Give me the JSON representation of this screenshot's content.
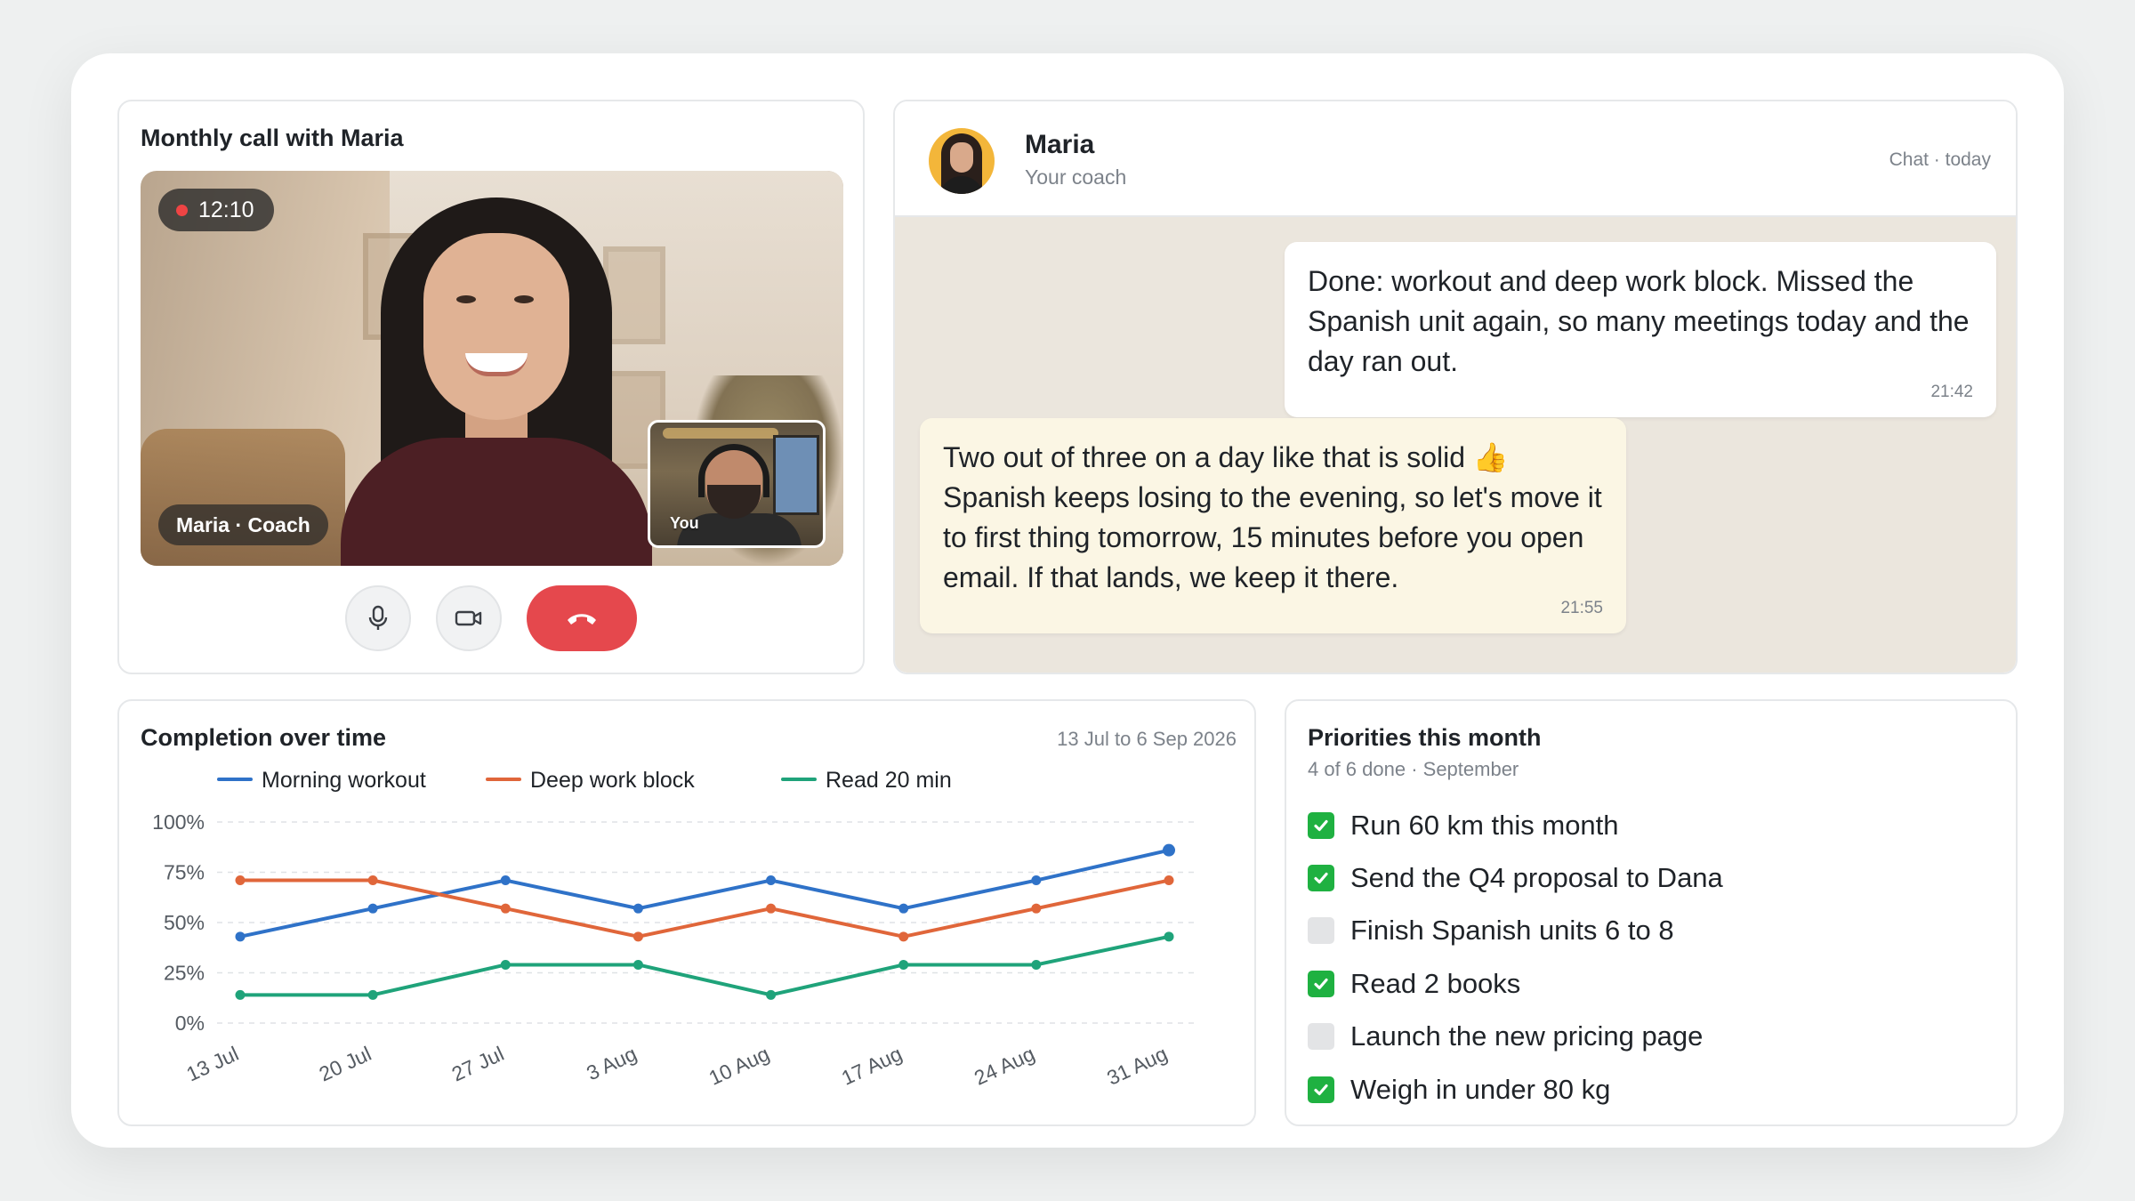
{
  "call": {
    "title": "Monthly call with Maria",
    "recording_time": "12:10",
    "remote_label": "Maria · Coach",
    "self_label": "You",
    "controls": [
      "microphone",
      "camera",
      "end-call"
    ],
    "accent_end_call": "#e5484d"
  },
  "chat": {
    "name": "Maria",
    "role": "Your coach",
    "meta": "Chat · today",
    "messages": [
      {
        "direction": "outgoing",
        "text": "Done: workout and deep work block. Missed the Spanish unit again, so many meetings today and the day ran out.",
        "time": "21:42"
      },
      {
        "direction": "incoming",
        "text": "Two out of three on a day like that is solid 👍 Spanish keeps losing to the evening, so let's move it to first thing tomorrow, 15 minutes before you open email. If that lands, we keep it there.",
        "time": "21:55"
      }
    ]
  },
  "chart": {
    "title": "Completion over time",
    "range": "13 Jul to 6 Sep 2026"
  },
  "chart_data": {
    "type": "line",
    "categories": [
      "13 Jul",
      "20 Jul",
      "27 Jul",
      "3 Aug",
      "10 Aug",
      "17 Aug",
      "24 Aug",
      "31 Aug"
    ],
    "y_ticks": [
      "0%",
      "25%",
      "50%",
      "75%",
      "100%"
    ],
    "ylim": [
      0,
      100
    ],
    "grid": true,
    "legend": "top",
    "series": [
      {
        "name": "Morning workout",
        "color": "#2f72c8",
        "values": [
          43,
          57,
          71,
          57,
          71,
          57,
          71,
          86
        ]
      },
      {
        "name": "Deep work block",
        "color": "#e0663a",
        "values": [
          71,
          71,
          57,
          43,
          57,
          43,
          57,
          71
        ]
      },
      {
        "name": "Read 20 min",
        "color": "#1fa37a",
        "values": [
          14,
          14,
          29,
          29,
          14,
          29,
          29,
          43
        ]
      }
    ]
  },
  "priorities": {
    "title": "Priorities this month",
    "subtitle": "4 of 6 done · September",
    "items": [
      {
        "label": "Run 60 km this month",
        "done": true
      },
      {
        "label": "Send the Q4 proposal to Dana",
        "done": true
      },
      {
        "label": "Finish Spanish units 6 to 8",
        "done": false
      },
      {
        "label": "Read 2 books",
        "done": true
      },
      {
        "label": "Launch the new pricing page",
        "done": false
      },
      {
        "label": "Weigh in under 80 kg",
        "done": true
      }
    ]
  }
}
